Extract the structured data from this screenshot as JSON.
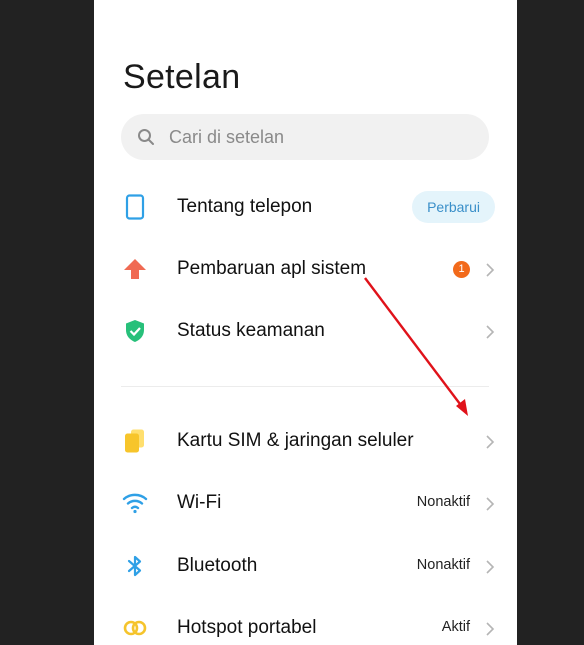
{
  "page": {
    "title": "Setelan"
  },
  "search": {
    "placeholder": "Cari di setelan",
    "icon": "search-icon"
  },
  "colors": {
    "accent_blue": "#2fa0e6",
    "update_pill_bg": "#e4f4fb",
    "update_pill_text": "#3a8fc9",
    "badge": "#f26a1b",
    "annotation_arrow": "#e0121a"
  },
  "settings": {
    "items": [
      {
        "label": "Tentang telepon",
        "icon": "phone-icon",
        "pill": "Perbarui"
      },
      {
        "label": "Pembaruan apl sistem",
        "icon": "arrow-up-icon",
        "badge": "1"
      },
      {
        "label": "Status keamanan",
        "icon": "shield-check-icon"
      },
      {
        "label": "Kartu SIM & jaringan seluler",
        "icon": "sim-card-icon"
      },
      {
        "label": "Wi-Fi",
        "icon": "wifi-icon",
        "value": "Nonaktif"
      },
      {
        "label": "Bluetooth",
        "icon": "bluetooth-icon",
        "value": "Nonaktif"
      },
      {
        "label": "Hotspot portabel",
        "icon": "hotspot-icon",
        "value": "Aktif"
      }
    ]
  }
}
